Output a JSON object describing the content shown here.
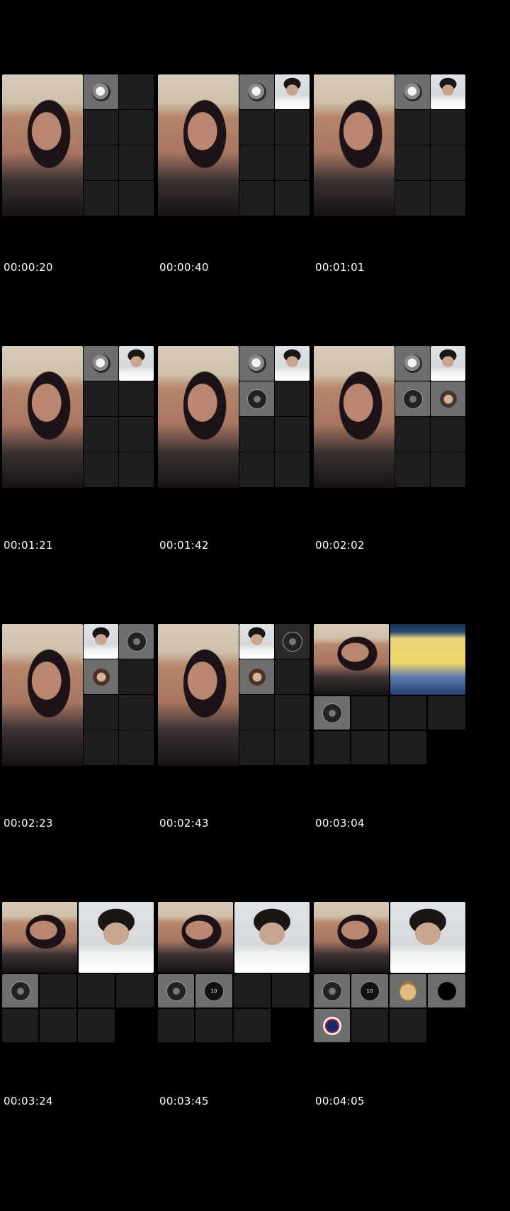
{
  "timestamps": [
    "00:00:20",
    "00:00:40",
    "00:01:01",
    "00:01:21",
    "00:01:42",
    "00:02:02",
    "00:02:23",
    "00:02:43",
    "00:03:04",
    "00:03:24",
    "00:03:45",
    "00:04:05"
  ],
  "jersey_number": "10",
  "colors": {
    "background": "#000000",
    "empty_tile": "#1e1e1e",
    "active_tile": "#6e6e6e"
  },
  "icons": [
    "mono-profile-avatar-icon",
    "dark-profile-avatar-icon",
    "group-photo-avatar-icon",
    "jersey-avatar-icon",
    "pet-avatar-icon",
    "black-avatar-icon",
    "psg-crest-avatar-icon"
  ]
}
